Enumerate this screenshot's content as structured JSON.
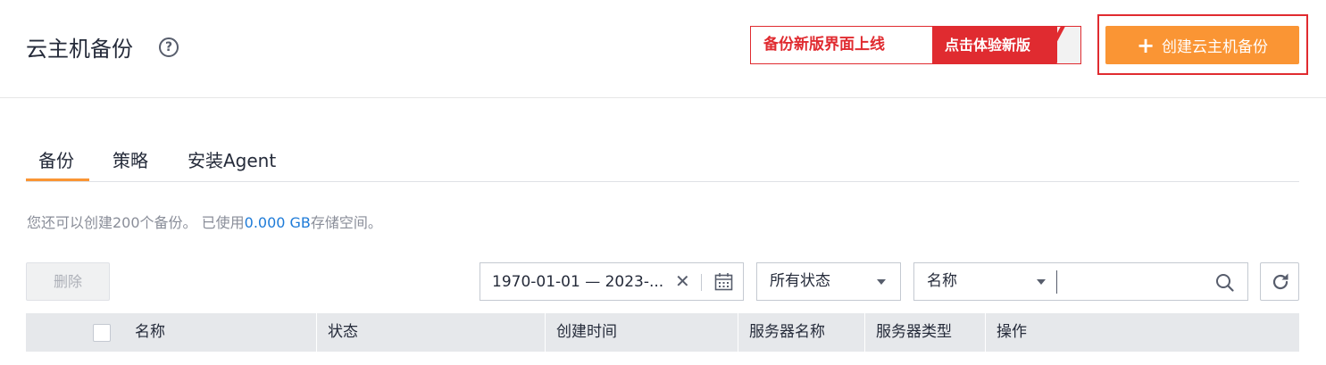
{
  "header": {
    "title": "云主机备份",
    "help_icon": "?",
    "promo_left": "备份新版界面上线",
    "promo_right": "点击体验新版",
    "create_button_label": "创建云主机备份",
    "create_button_icon": "+"
  },
  "tabs": [
    {
      "label": "备份",
      "active": true
    },
    {
      "label": "策略",
      "active": false
    },
    {
      "label": "安装Agent",
      "active": false
    }
  ],
  "info": {
    "prefix": "您还可以创建200个备份。 已使用",
    "used": "0.000 GB",
    "suffix": "存储空间。"
  },
  "toolbar": {
    "delete_label": "删除",
    "date_range": "1970-01-01 — 2023-...",
    "clear_icon": "✕",
    "status_filter": "所有状态",
    "search_field": "名称",
    "search_value": ""
  },
  "table": {
    "columns": [
      "名称",
      "状态",
      "创建时间",
      "服务器名称",
      "服务器类型",
      "操作"
    ]
  },
  "colors": {
    "accent": "#fa9534",
    "promo_red": "#e02b30",
    "link_blue": "#1e7bd8",
    "header_bg": "#e6e8eb"
  }
}
